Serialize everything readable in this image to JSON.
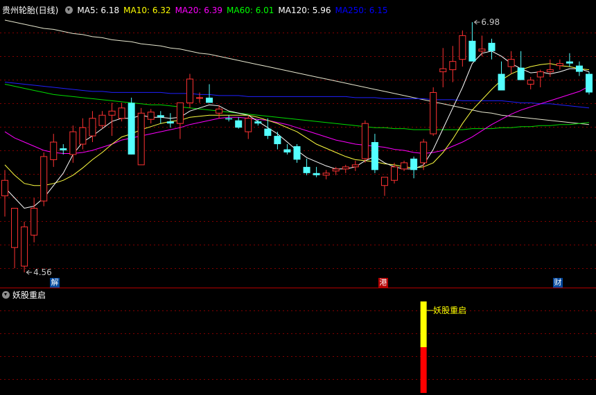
{
  "header": {
    "stock_title": "贵州轮胎(日线)",
    "ma_items": [
      {
        "label": "MA5: 6.18",
        "color": "#ffffff"
      },
      {
        "label": "MA10: 6.32",
        "color": "#ffff00"
      },
      {
        "label": "MA20: 6.39",
        "color": "#ff00ff"
      },
      {
        "label": "MA60: 6.01",
        "color": "#00ff00"
      },
      {
        "label": "MA120: 5.96",
        "color": "#ffffff"
      },
      {
        "label": "MA250: 6.15",
        "color": "#0000ff"
      }
    ]
  },
  "price_annotations": {
    "high": "6.98",
    "low": "4.56"
  },
  "event_tags": {
    "tag1": "解",
    "tag2": "港",
    "tag3": "财"
  },
  "indicator": {
    "title": "妖股重启",
    "signal_label": "妖股重启"
  },
  "colors": {
    "up": "#ff3232",
    "down": "#54ffff",
    "grid": "#840000",
    "sep": "#b40000"
  },
  "candles": [
    [
      5.3,
      5.55,
      5.1,
      5.45
    ],
    [
      4.8,
      5.05,
      4.6,
      5.18
    ],
    [
      4.62,
      5.05,
      4.56,
      5.0
    ],
    [
      4.92,
      5.28,
      4.85,
      5.18
    ],
    [
      5.25,
      5.72,
      5.2,
      5.68
    ],
    [
      5.65,
      5.9,
      5.58,
      5.82
    ],
    [
      5.76,
      5.8,
      5.7,
      5.74
    ],
    [
      5.7,
      5.98,
      5.62,
      5.92
    ],
    [
      5.8,
      6.05,
      5.75,
      5.96
    ],
    [
      5.88,
      6.12,
      5.82,
      6.05
    ],
    [
      5.98,
      6.12,
      5.95,
      6.08
    ],
    [
      6.08,
      6.2,
      5.88,
      6.12
    ],
    [
      6.05,
      6.2,
      6.02,
      6.15
    ],
    [
      6.2,
      6.25,
      5.7,
      5.7
    ],
    [
      5.6,
      6.15,
      5.6,
      6.1
    ],
    [
      6.04,
      6.14,
      6.0,
      6.11
    ],
    [
      6.08,
      6.12,
      6.0,
      6.06
    ],
    [
      6.02,
      6.1,
      5.96,
      6.0
    ],
    [
      6.0,
      6.18,
      5.85,
      6.2
    ],
    [
      6.2,
      6.48,
      6.15,
      6.43
    ],
    [
      6.25,
      6.3,
      6.2,
      6.25
    ],
    [
      6.25,
      6.38,
      6.2,
      6.2
    ],
    [
      6.1,
      6.18,
      6.05,
      6.14
    ],
    [
      6.05,
      6.08,
      6.02,
      6.04
    ],
    [
      6.03,
      6.06,
      5.95,
      5.96
    ],
    [
      5.92,
      6.08,
      5.85,
      6.05
    ],
    [
      6.02,
      6.04,
      5.98,
      6.0
    ],
    [
      5.95,
      6.05,
      5.85,
      5.88
    ],
    [
      5.88,
      5.92,
      5.75,
      5.8
    ],
    [
      5.75,
      5.8,
      5.7,
      5.72
    ],
    [
      5.78,
      5.8,
      5.62,
      5.65
    ],
    [
      5.58,
      5.66,
      5.5,
      5.52
    ],
    [
      5.52,
      5.58,
      5.48,
      5.5
    ],
    [
      5.5,
      5.55,
      5.46,
      5.52
    ],
    [
      5.54,
      5.58,
      5.5,
      5.56
    ],
    [
      5.56,
      5.6,
      5.52,
      5.58
    ],
    [
      5.58,
      5.64,
      5.54,
      5.6
    ],
    [
      5.66,
      6.03,
      5.62,
      6.0
    ],
    [
      5.82,
      5.9,
      5.52,
      5.55
    ],
    [
      5.4,
      5.48,
      5.3,
      5.48
    ],
    [
      5.45,
      5.62,
      5.42,
      5.58
    ],
    [
      5.56,
      5.64,
      5.54,
      5.62
    ],
    [
      5.66,
      5.68,
      5.47,
      5.55
    ],
    [
      5.62,
      5.85,
      5.55,
      5.82
    ],
    [
      5.9,
      6.35,
      5.88,
      6.3
    ],
    [
      6.5,
      6.73,
      6.35,
      6.53
    ],
    [
      6.52,
      6.75,
      6.4,
      6.6
    ],
    [
      6.62,
      6.9,
      6.55,
      6.85
    ],
    [
      6.8,
      6.98,
      6.6,
      6.6
    ],
    [
      6.7,
      6.85,
      6.65,
      6.72
    ],
    [
      6.78,
      6.82,
      6.62,
      6.7
    ],
    [
      6.48,
      6.6,
      6.4,
      6.32
    ],
    [
      6.55,
      6.7,
      6.48,
      6.62
    ],
    [
      6.54,
      6.7,
      6.48,
      6.42
    ],
    [
      6.38,
      6.45,
      6.33,
      6.42
    ],
    [
      6.45,
      6.52,
      6.35,
      6.5
    ],
    [
      6.5,
      6.62,
      6.45,
      6.52
    ],
    [
      6.56,
      6.62,
      6.52,
      6.58
    ],
    [
      6.6,
      6.68,
      6.55,
      6.58
    ],
    [
      6.56,
      6.6,
      6.46,
      6.5
    ],
    [
      6.48,
      6.5,
      6.28,
      6.3
    ]
  ],
  "ma_lines": {
    "ma5": [
      5.38,
      5.28,
      5.18,
      5.2,
      5.28,
      5.4,
      5.52,
      5.7,
      5.82,
      5.88,
      5.95,
      6.02,
      6.05,
      6.05,
      6.08,
      6.06,
      6.06,
      6.05,
      6.06,
      6.12,
      6.15,
      6.18,
      6.17,
      6.12,
      6.1,
      6.08,
      6.02,
      5.96,
      5.9,
      5.82,
      5.74,
      5.67,
      5.63,
      5.59,
      5.56,
      5.56,
      5.58,
      5.64,
      5.68,
      5.62,
      5.58,
      5.56,
      5.56,
      5.6,
      5.75,
      5.95,
      6.15,
      6.35,
      6.58,
      6.68,
      6.7,
      6.65,
      6.58,
      6.53,
      6.49,
      6.5,
      6.48,
      6.5,
      6.53,
      6.53,
      6.5
    ],
    "ma10": [
      5.6,
      5.5,
      5.42,
      5.4,
      5.4,
      5.42,
      5.45,
      5.5,
      5.57,
      5.65,
      5.72,
      5.8,
      5.87,
      5.9,
      5.94,
      5.97,
      6.0,
      6.02,
      6.03,
      6.06,
      6.07,
      6.08,
      6.08,
      6.08,
      6.08,
      6.08,
      6.06,
      6.03,
      6.0,
      5.96,
      5.92,
      5.86,
      5.8,
      5.76,
      5.72,
      5.68,
      5.65,
      5.64,
      5.63,
      5.61,
      5.6,
      5.58,
      5.57,
      5.58,
      5.62,
      5.72,
      5.85,
      6.0,
      6.13,
      6.23,
      6.33,
      6.42,
      6.48,
      6.52,
      6.55,
      6.57,
      6.58,
      6.56,
      6.55,
      6.53,
      6.52
    ],
    "ma20": [
      5.92,
      5.86,
      5.82,
      5.78,
      5.74,
      5.72,
      5.71,
      5.71,
      5.72,
      5.74,
      5.77,
      5.8,
      5.84,
      5.86,
      5.88,
      5.9,
      5.92,
      5.94,
      5.96,
      5.99,
      6.01,
      6.03,
      6.05,
      6.06,
      6.06,
      6.05,
      6.04,
      6.03,
      6.01,
      5.99,
      5.96,
      5.93,
      5.9,
      5.87,
      5.84,
      5.82,
      5.8,
      5.79,
      5.78,
      5.77,
      5.75,
      5.74,
      5.72,
      5.71,
      5.72,
      5.74,
      5.78,
      5.82,
      5.87,
      5.93,
      5.99,
      6.04,
      6.09,
      6.13,
      6.16,
      6.19,
      6.22,
      6.25,
      6.28,
      6.31,
      6.36
    ],
    "ma60": [
      6.38,
      6.36,
      6.34,
      6.32,
      6.3,
      6.28,
      6.27,
      6.26,
      6.25,
      6.24,
      6.23,
      6.22,
      6.21,
      6.2,
      6.19,
      6.18,
      6.18,
      6.17,
      6.16,
      6.15,
      6.14,
      6.13,
      6.12,
      6.11,
      6.1,
      6.09,
      6.08,
      6.07,
      6.06,
      6.05,
      6.04,
      6.03,
      6.02,
      6.01,
      6.0,
      5.99,
      5.98,
      5.97,
      5.96,
      5.96,
      5.95,
      5.95,
      5.94,
      5.94,
      5.94,
      5.94,
      5.94,
      5.94,
      5.95,
      5.95,
      5.95,
      5.96,
      5.96,
      5.97,
      5.97,
      5.98,
      5.98,
      5.99,
      5.99,
      6.0,
      6.01
    ],
    "ma120": [
      7.0,
      6.98,
      6.96,
      6.94,
      6.92,
      6.91,
      6.89,
      6.87,
      6.86,
      6.84,
      6.83,
      6.81,
      6.8,
      6.79,
      6.77,
      6.76,
      6.75,
      6.73,
      6.72,
      6.7,
      6.68,
      6.67,
      6.65,
      6.63,
      6.61,
      6.59,
      6.57,
      6.55,
      6.53,
      6.51,
      6.49,
      6.47,
      6.45,
      6.43,
      6.41,
      6.39,
      6.37,
      6.35,
      6.33,
      6.31,
      6.29,
      6.27,
      6.25,
      6.23,
      6.21,
      6.19,
      6.17,
      6.15,
      6.13,
      6.11,
      6.1,
      6.08,
      6.07,
      6.06,
      6.05,
      6.04,
      6.03,
      6.02,
      6.01,
      6.0,
      5.99
    ],
    "ma250": [
      6.4,
      6.39,
      6.38,
      6.37,
      6.36,
      6.35,
      6.34,
      6.33,
      6.32,
      6.31,
      6.31,
      6.3,
      6.3,
      6.3,
      6.3,
      6.3,
      6.3,
      6.29,
      6.29,
      6.29,
      6.28,
      6.28,
      6.27,
      6.27,
      6.27,
      6.26,
      6.26,
      6.26,
      6.26,
      6.26,
      6.26,
      6.26,
      6.26,
      6.26,
      6.26,
      6.26,
      6.25,
      6.25,
      6.25,
      6.24,
      6.24,
      6.24,
      6.24,
      6.24,
      6.23,
      6.23,
      6.23,
      6.22,
      6.22,
      6.22,
      6.22,
      6.22,
      6.21,
      6.2,
      6.2,
      6.19,
      6.19,
      6.18,
      6.17,
      6.16,
      6.15
    ]
  },
  "signal": {
    "candle_index": 43,
    "red_fraction": 0.5
  }
}
